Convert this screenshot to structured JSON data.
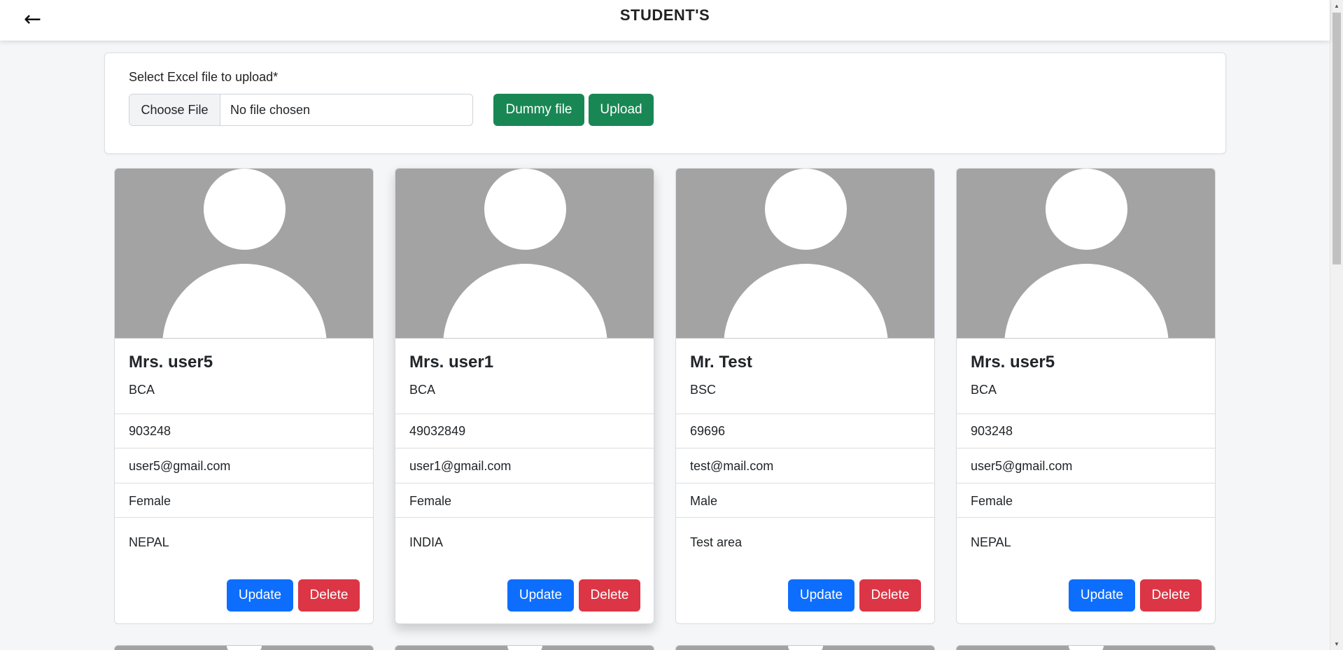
{
  "header": {
    "back_icon": "←",
    "title": "STUDENT'S"
  },
  "upload": {
    "label": "Select Excel file to upload*",
    "choose_label": "Choose File",
    "file_status": "No file chosen",
    "dummy_label": "Dummy file",
    "upload_label": "Upload"
  },
  "colors": {
    "success": "#198754",
    "primary": "#0d6efd",
    "danger": "#dc3545",
    "avatar_bg": "#a3a3a3"
  },
  "students": [
    {
      "name": "Mrs. user5",
      "course": "BCA",
      "phone": "903248",
      "email": "user5@gmail.com",
      "gender": "Female",
      "address": "NEPAL",
      "update_label": "Update",
      "delete_label": "Delete"
    },
    {
      "name": "Mrs. user1",
      "course": "BCA",
      "phone": "49032849",
      "email": "user1@gmail.com",
      "gender": "Female",
      "address": "INDIA",
      "update_label": "Update",
      "delete_label": "Delete"
    },
    {
      "name": "Mr. Test",
      "course": "BSC",
      "phone": "69696",
      "email": "test@mail.com",
      "gender": "Male",
      "address": "Test area",
      "update_label": "Update",
      "delete_label": "Delete"
    },
    {
      "name": "Mrs. user5",
      "course": "BCA",
      "phone": "903248",
      "email": "user5@gmail.com",
      "gender": "Female",
      "address": "NEPAL",
      "update_label": "Update",
      "delete_label": "Delete"
    }
  ],
  "scroll": {
    "up_icon": "▲",
    "down_icon": "▼"
  }
}
